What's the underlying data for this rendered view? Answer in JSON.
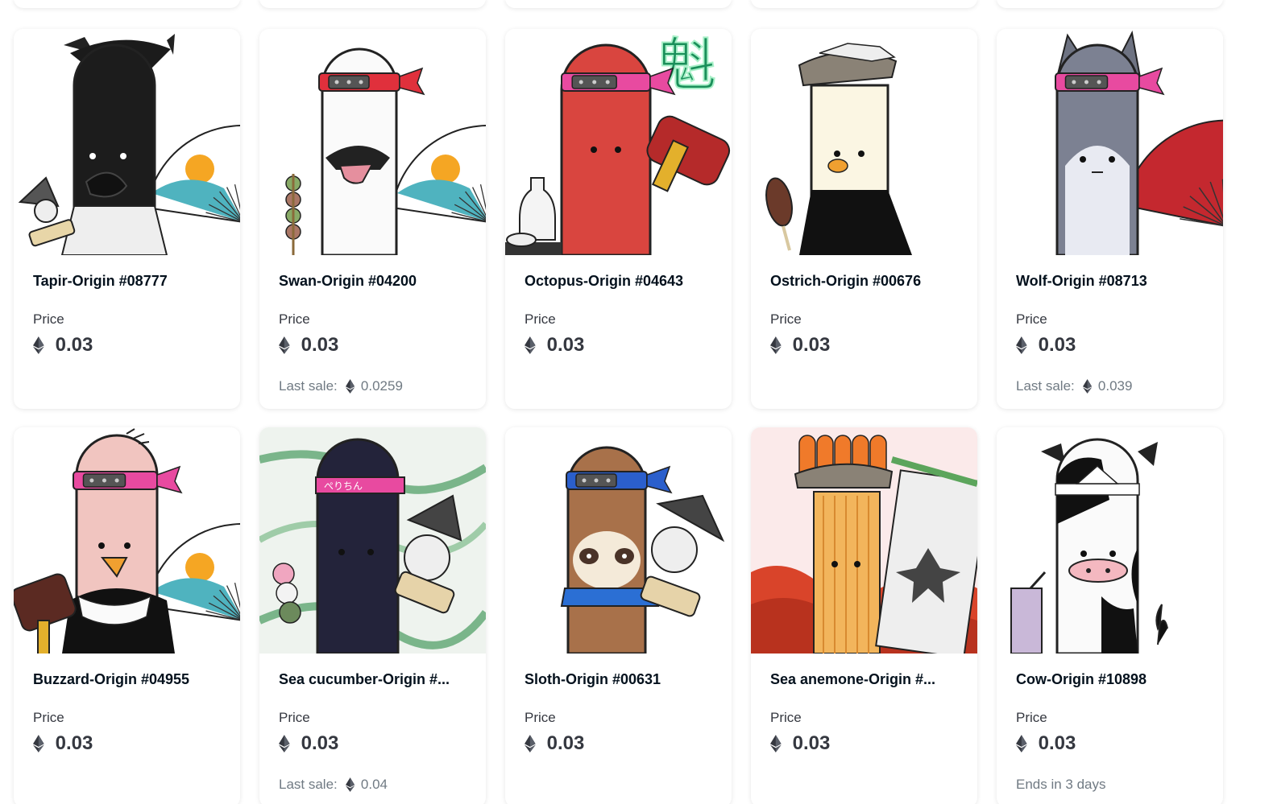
{
  "colors": {
    "text_primary": "#04111d",
    "text_secondary": "#353840",
    "text_muted": "#707a83",
    "card_bg": "#ffffff"
  },
  "currency_icon": "ethereum-icon",
  "cards": [
    {
      "name": "Tapir-Origin #08777",
      "price_label": "Price",
      "price": "0.03",
      "footer_type": "none",
      "character": "tapir"
    },
    {
      "name": "Swan-Origin #04200",
      "price_label": "Price",
      "price": "0.03",
      "footer_type": "last_sale",
      "footer_label": "Last sale:",
      "footer_value": "0.0259",
      "character": "swan"
    },
    {
      "name": "Octopus-Origin #04643",
      "price_label": "Price",
      "price": "0.03",
      "footer_type": "none",
      "character": "octopus"
    },
    {
      "name": "Ostrich-Origin #00676",
      "price_label": "Price",
      "price": "0.03",
      "footer_type": "none",
      "character": "ostrich"
    },
    {
      "name": "Wolf-Origin #08713",
      "price_label": "Price",
      "price": "0.03",
      "footer_type": "last_sale",
      "footer_label": "Last sale:",
      "footer_value": "0.039",
      "character": "wolf"
    },
    {
      "name": "Buzzard-Origin #04955",
      "price_label": "Price",
      "price": "0.03",
      "footer_type": "none",
      "character": "buzzard"
    },
    {
      "name": "Sea cucumber-Origin #...",
      "price_label": "Price",
      "price": "0.03",
      "footer_type": "last_sale",
      "footer_label": "Last sale:",
      "footer_value": "0.04",
      "character": "sea-cucumber"
    },
    {
      "name": "Sloth-Origin #00631",
      "price_label": "Price",
      "price": "0.03",
      "footer_type": "none",
      "character": "sloth"
    },
    {
      "name": "Sea anemone-Origin #...",
      "price_label": "Price",
      "price": "0.03",
      "footer_type": "none",
      "character": "sea-anemone"
    },
    {
      "name": "Cow-Origin #10898",
      "price_label": "Price",
      "price": "0.03",
      "footer_type": "ends",
      "footer_label": "Ends in 3 days",
      "character": "cow"
    }
  ]
}
